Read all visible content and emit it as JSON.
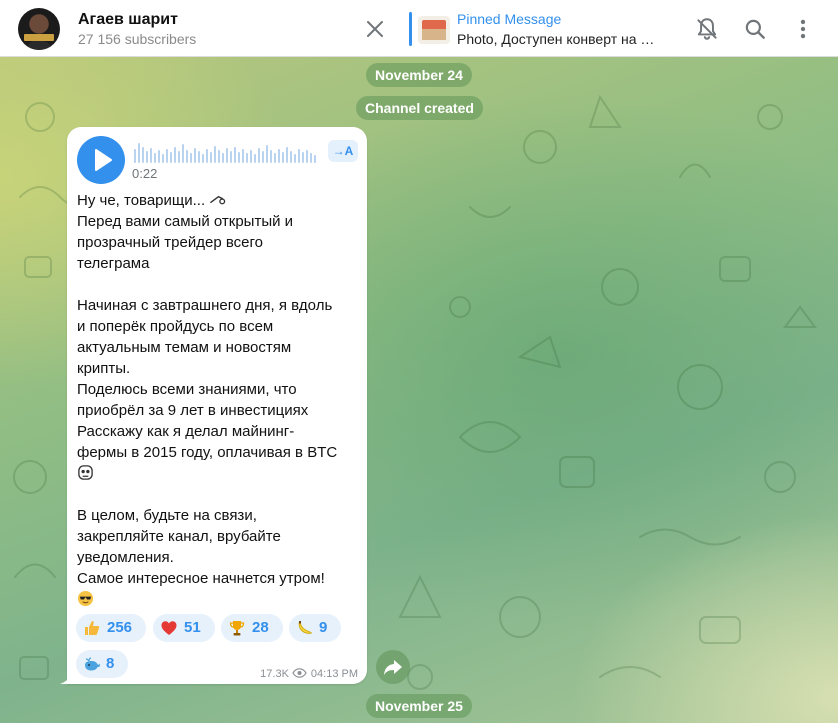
{
  "header": {
    "channel_title": "Агаев шарит",
    "subscribers": "27 156 subscribers",
    "pinned_title": "Pinned Message",
    "pinned_text": "Photo, Доступен конверт на …",
    "icons": [
      "close-icon",
      "mute-bell-icon",
      "search-icon",
      "more-vertical-icon"
    ]
  },
  "chat": {
    "date_top": "November 24",
    "service_message": "Channel created",
    "date_bottom": "November 25"
  },
  "message": {
    "voice_duration": "0:22",
    "transcribe_label": "→A",
    "lines": [
      "Ну че, товарищи... ",
      "Перед вами самый открытый и",
      "прозрачный трейдер всего",
      "телеграма",
      "",
      "Начиная с завтрашнего дня, я вдоль",
      "и поперёк пройдусь по всем",
      "актуальным темам и новостям",
      "крипты.",
      "Поделюсь всеми знаниями, что",
      "приобрёл за 9 лет в инвестициях",
      "Расскажу как я делал майнинг-",
      "фермы в 2015 году, оплачивая в BTC",
      "",
      "",
      "В целом, будьте на связи,",
      "закрепляйте канал, врубайте",
      "уведомления.",
      "Самое интересное начнется утром!",
      ""
    ],
    "reactions": [
      {
        "emoji": "thumbs-up",
        "count": "256"
      },
      {
        "emoji": "heart",
        "count": "51"
      },
      {
        "emoji": "trophy",
        "count": "28"
      },
      {
        "emoji": "banana",
        "count": "9"
      },
      {
        "emoji": "whale",
        "count": "8"
      }
    ],
    "views": "17.3K",
    "time": "04:13 PM"
  },
  "colors": {
    "accent": "#3390ec",
    "bubble": "#ffffff",
    "header": "#ffffff"
  }
}
